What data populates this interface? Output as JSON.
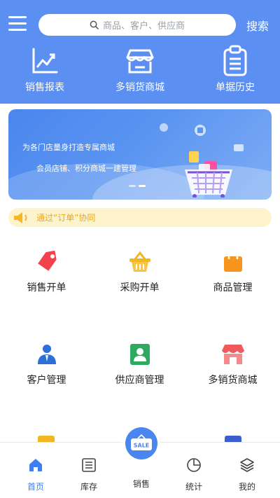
{
  "header": {
    "menu_icon": "hamburger-menu-icon",
    "search_placeholder": "商品、客户、供应商",
    "search_button": "搜索",
    "background": "#5b8ff2"
  },
  "quick_actions": [
    {
      "label": "销售报表",
      "icon": "chart-icon"
    },
    {
      "label": "多销货商城",
      "icon": "store-icon"
    },
    {
      "label": "单据历史",
      "icon": "clipboard-icon"
    }
  ],
  "banner": {
    "line1": "为各门店量身打造专属商城",
    "line2": "会员店铺、积分商城一建管理",
    "active_slide": 2,
    "slide_count": 2
  },
  "notice": {
    "text": "通过“订单”协同",
    "icon": "speaker-icon"
  },
  "grid": [
    {
      "label": "销售开单",
      "icon": "tag-icon"
    },
    {
      "label": "采购开单",
      "icon": "basket-icon"
    },
    {
      "label": "商品管理",
      "icon": "bag-icon"
    },
    {
      "label": "客户管理",
      "icon": "person-icon"
    },
    {
      "label": "供应商管理",
      "icon": "contact-card-icon"
    },
    {
      "label": "多销货商城",
      "icon": "shop-icon"
    }
  ],
  "tabs": [
    {
      "label": "首页",
      "icon": "home-icon",
      "active": true
    },
    {
      "label": "库存",
      "icon": "list-icon",
      "active": false
    },
    {
      "label": "销售",
      "icon": "sale-icon",
      "active": false,
      "badge": "SALE"
    },
    {
      "label": "统计",
      "icon": "pie-chart-icon",
      "active": false
    },
    {
      "label": "我的",
      "icon": "layers-icon",
      "active": false
    }
  ]
}
